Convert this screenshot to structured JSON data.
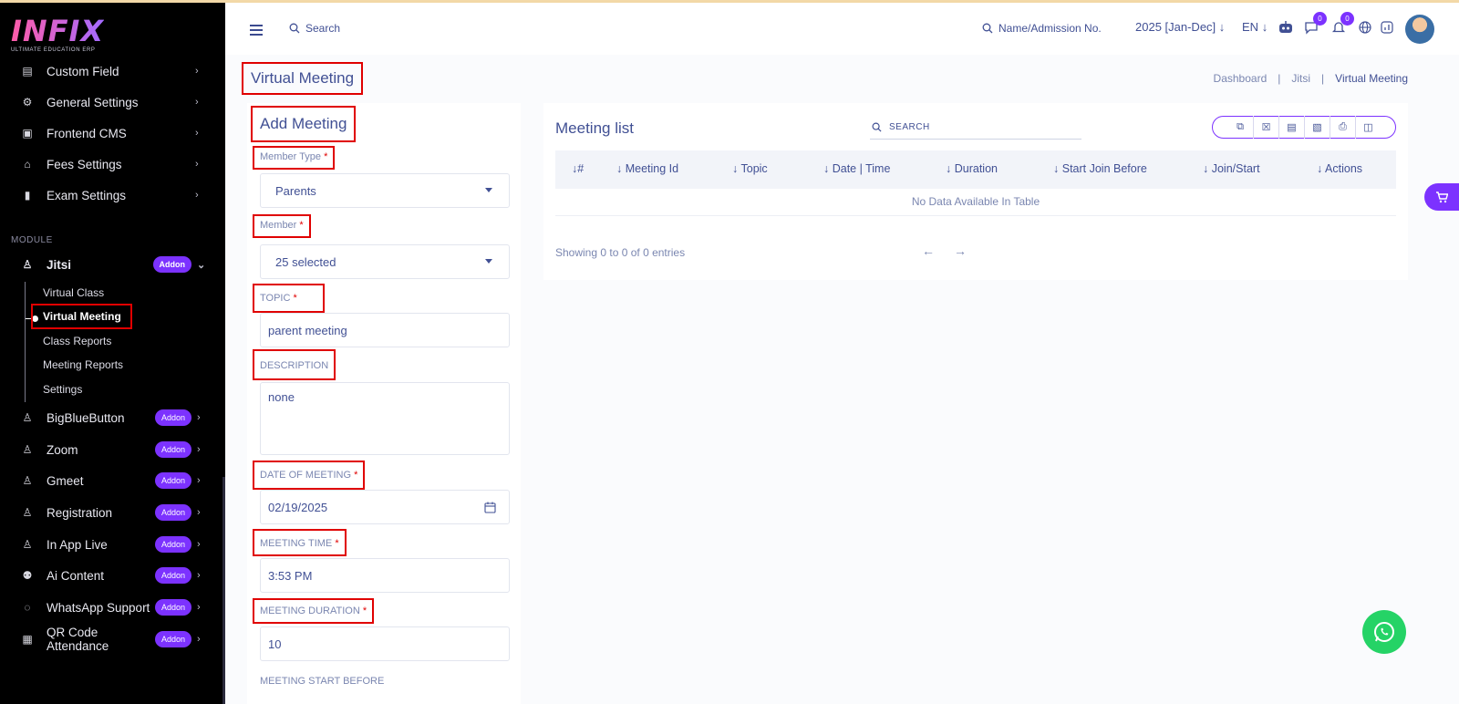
{
  "logo": {
    "name": "INFIX",
    "tagline": "ULTIMATE EDUCATION ERP"
  },
  "sidebar": {
    "top_items": [
      {
        "label": "Custom Field",
        "icon": "bed-icon"
      },
      {
        "label": "General Settings",
        "icon": "gears-icon"
      },
      {
        "label": "Frontend CMS",
        "icon": "monitor-icon"
      },
      {
        "label": "Fees Settings",
        "icon": "bank-icon"
      },
      {
        "label": "Exam Settings",
        "icon": "book-icon"
      }
    ],
    "module_label": "MODULE",
    "jitsi": {
      "label": "Jitsi",
      "badge": "Addon"
    },
    "jitsi_subitems": [
      "Virtual Class",
      "Virtual Meeting",
      "Class Reports",
      "Meeting Reports",
      "Settings"
    ],
    "addon_items": [
      {
        "label": "BigBlueButton",
        "badge": "Addon",
        "icon": "person-icon"
      },
      {
        "label": "Zoom",
        "badge": "Addon",
        "icon": "person-icon"
      },
      {
        "label": "Gmeet",
        "badge": "Addon",
        "icon": "person-icon"
      },
      {
        "label": "Registration",
        "badge": "Addon",
        "icon": "person-icon"
      },
      {
        "label": "In App Live",
        "badge": "Addon",
        "icon": "person-icon"
      },
      {
        "label": "Ai Content",
        "badge": "Addon",
        "icon": "robot-icon"
      },
      {
        "label": "WhatsApp Support",
        "badge": "Addon",
        "icon": "whatsapp-icon"
      },
      {
        "label": "QR Code Attendance",
        "badge": "Addon",
        "icon": "qr-icon"
      }
    ]
  },
  "header": {
    "search_label": "Search",
    "name_search_label": "Name/Admission No.",
    "year": "2025 [Jan-Dec]",
    "lang": "EN",
    "messages_count": "0",
    "notifications_count": "0"
  },
  "page": {
    "title": "Virtual Meeting",
    "breadcrumb": [
      "Dashboard",
      "Jitsi",
      "Virtual Meeting"
    ]
  },
  "form": {
    "title": "Add Meeting",
    "member_type_label": "Member Type",
    "member_type_value": "Parents",
    "member_label": "Member",
    "member_value": "25 selected",
    "topic_label": "TOPIC",
    "topic_value": "parent meeting",
    "description_label": "DESCRIPTION",
    "description_value": "none",
    "date_label": "DATE OF MEETING",
    "date_value": "02/19/2025",
    "time_label": "MEETING TIME",
    "time_value": "3:53 PM",
    "duration_label": "MEETING DURATION",
    "duration_value": "10",
    "start_before_label": "MEETING START BEFORE",
    "required_mark": "*"
  },
  "list": {
    "title": "Meeting list",
    "search_placeholder": "SEARCH",
    "columns": [
      "#",
      "Meeting Id",
      "Topic",
      "Date | Time",
      "Duration",
      "Start Join Before",
      "Join/Start",
      "Actions"
    ],
    "empty_text": "No Data Available In Table",
    "showing_text": "Showing 0 to 0 of 0 entries"
  },
  "colors": {
    "accent": "#7c32ff",
    "primary_text": "#415094",
    "sidebar_bg": "#000000",
    "highlight": "#e00000",
    "whatsapp": "#25d366"
  }
}
